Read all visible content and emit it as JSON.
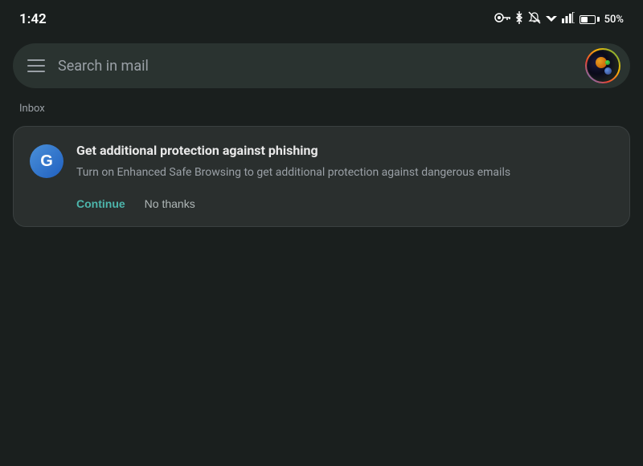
{
  "statusBar": {
    "time": "1:42",
    "battery": "50%",
    "icons": {
      "vpn": "⚿",
      "bluetooth": "✶",
      "silent": "🔕",
      "wifi": "▼",
      "signal": "◣"
    }
  },
  "searchBar": {
    "placeholder": "Search in mail"
  },
  "inboxLabel": "Inbox",
  "notificationCard": {
    "title": "Get additional protection against phishing",
    "description": "Turn on Enhanced Safe Browsing to get additional protection against dangerous emails",
    "continueButton": "Continue",
    "noThanksButton": "No thanks"
  }
}
